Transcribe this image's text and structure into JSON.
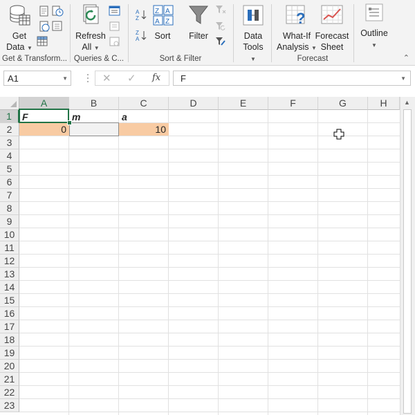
{
  "ribbon": {
    "groups": [
      {
        "label": "Get & Transform...",
        "buttons": [
          {
            "label_line1": "Get",
            "label_line2": "Data"
          }
        ]
      },
      {
        "label": "Queries & C...",
        "buttons": [
          {
            "label_line1": "Refresh",
            "label_line2": "All"
          }
        ]
      },
      {
        "label": "Sort & Filter",
        "buttons": [
          {
            "label": "Sort"
          },
          {
            "label": "Filter"
          }
        ]
      },
      {
        "label": "",
        "buttons": [
          {
            "label_line1": "Data",
            "label_line2": "Tools"
          }
        ]
      },
      {
        "label": "Forecast",
        "buttons": [
          {
            "label_line1": "What-If",
            "label_line2": "Analysis"
          },
          {
            "label_line1": "Forecast",
            "label_line2": "Sheet"
          }
        ]
      },
      {
        "label": "",
        "buttons": [
          {
            "label": "Outline"
          }
        ]
      }
    ]
  },
  "formula_bar": {
    "name_box": "A1",
    "fx_label": "fx",
    "content": "F"
  },
  "columns": [
    "A",
    "B",
    "C",
    "D",
    "E",
    "F",
    "G",
    "H"
  ],
  "rows": [
    "1",
    "2",
    "3",
    "4",
    "5",
    "6",
    "7",
    "8",
    "9",
    "10",
    "11",
    "12",
    "13",
    "14",
    "15",
    "16",
    "17",
    "18",
    "19",
    "20",
    "21",
    "22",
    "23"
  ],
  "cells": {
    "A1": "F",
    "B1": "m",
    "C1": "a",
    "A2": "0",
    "C2": "10"
  },
  "colors": {
    "accent": "#217346",
    "highlight_orange": "#f8cba3",
    "grey_fill": "#f2f2f2"
  }
}
